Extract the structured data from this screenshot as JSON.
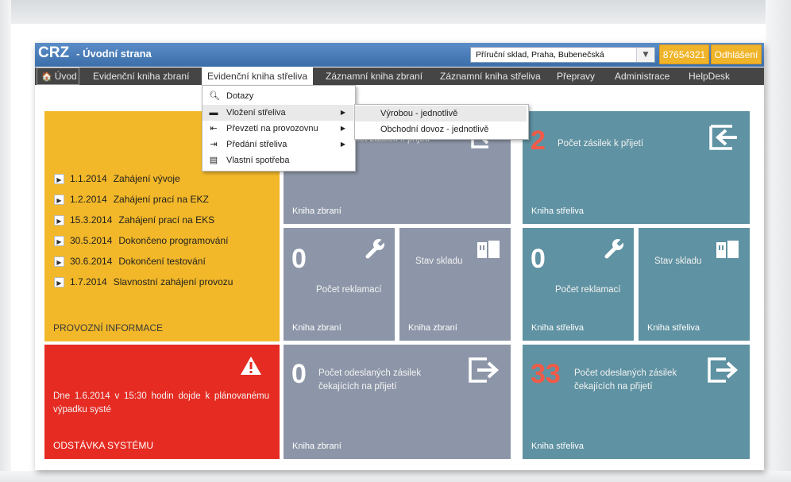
{
  "app": {
    "title_short": "CRZ",
    "title_page": "- Úvodní strana",
    "warehouse": "Příruční sklad, Praha, Bubenečská",
    "user_id": "87654321",
    "logout": "Odhlášení"
  },
  "menu": {
    "home": "Úvod",
    "items": [
      "Evidenční kniha zbraní",
      "Evidenční kniha střeliva",
      "Záznamní kniha zbraní",
      "Záznamní kniha střeliva",
      "Přepravy",
      "Administrace",
      "HelpDesk"
    ]
  },
  "dropdown": {
    "items": [
      {
        "label": "Dotazy",
        "icon": "magnifier-icon"
      },
      {
        "label": "Vložení střeliva",
        "icon": "insert-icon"
      },
      {
        "label": "Převzetí na provozovnu",
        "icon": "receive-icon"
      },
      {
        "label": "Předání střeliva",
        "icon": "handover-icon"
      },
      {
        "label": "Vlastní spotřeba",
        "icon": "document-icon"
      }
    ],
    "submenu": [
      "Výrobou - jednotlivě",
      "Obchodní dovoz - jednotlivě"
    ]
  },
  "info_tile": {
    "news": [
      {
        "date": "1.1.2014",
        "text": "Zahájení vývoje"
      },
      {
        "date": "1.2.2014",
        "text": "Zahájení prací na EKZ"
      },
      {
        "date": "15.3.2014",
        "text": "Zahájení prací na EKS"
      },
      {
        "date": "30.5.2014",
        "text": "Dokončeno programování"
      },
      {
        "date": "30.6.2014",
        "text": "Dokončení testování"
      },
      {
        "date": "1.7.2014",
        "text": "Slavnostní zahájení provozu"
      }
    ],
    "footer": "PROVOZNÍ INFORMACE"
  },
  "outage_tile": {
    "message": "Dne 1.6.2014 v 15:30 hodin dojde k plánovanému výpadku systé",
    "footer": "ODSTÁVKA SYSTÉMU"
  },
  "tiles": {
    "weapons_incoming": {
      "text": "Počet zásilek k přijetí",
      "footer": "Kniha zbraní"
    },
    "ammo_incoming": {
      "count": "2",
      "text": "Počet zásilek k přijetí",
      "footer": "Kniha střeliva"
    },
    "weapons_complaints": {
      "count": "0",
      "text": "Počet reklamací",
      "footer": "Kniha zbraní"
    },
    "weapons_stock": {
      "text": "Stav skladu",
      "footer": "Kniha zbraní"
    },
    "ammo_complaints": {
      "count": "0",
      "text": "Počet reklamací",
      "footer": "Kniha střeliva"
    },
    "ammo_stock": {
      "text": "Stav skladu",
      "footer": "Kniha střeliva"
    },
    "weapons_sent": {
      "count": "0",
      "text1": "Počet odeslaných zásilek",
      "text2": "čekajících na přijetí",
      "footer": "Kniha zbraní"
    },
    "ammo_sent": {
      "count": "33",
      "text1": "Počet odeslaných zásilek",
      "text2": "čekajících na přijetí",
      "footer": "Kniha střeliva"
    }
  },
  "colors": {
    "header_blue": "#3b6faa",
    "menubar": "#454545",
    "accent_yellow": "#f2b829",
    "alert_red": "#e52b22",
    "tile_gray": "#8d96a8",
    "tile_teal": "#5f92a2"
  }
}
